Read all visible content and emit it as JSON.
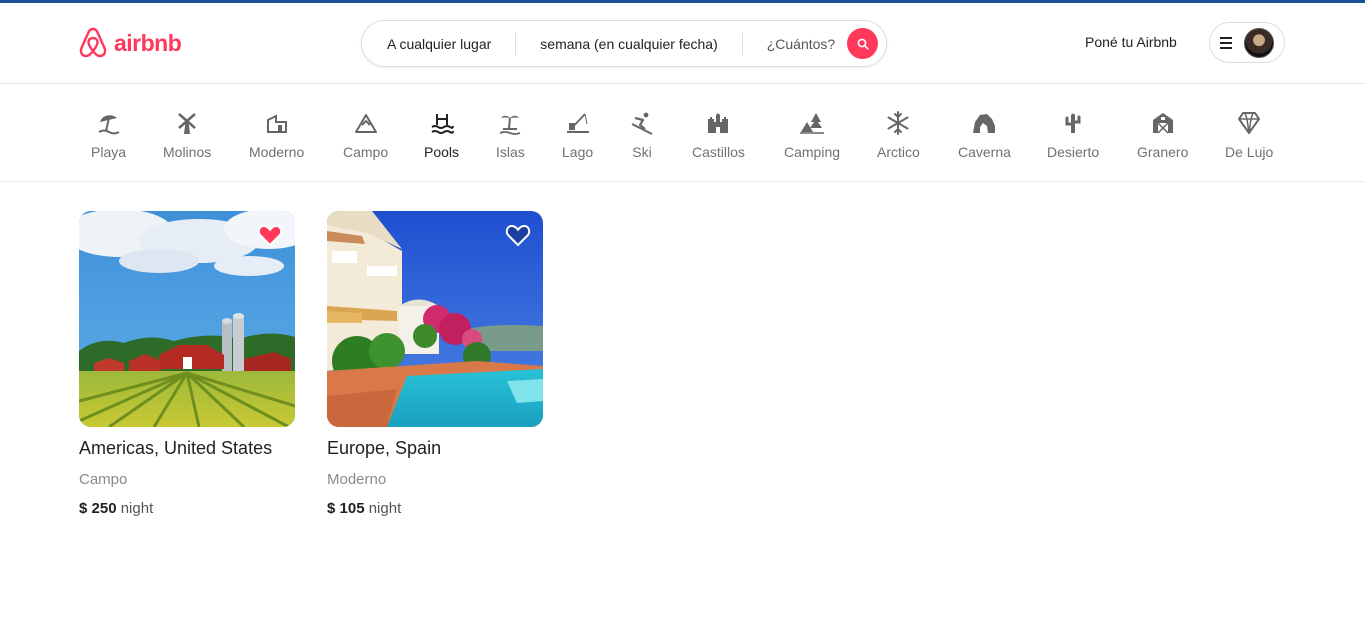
{
  "brand": {
    "name": "airbnb",
    "color": "#ff385c",
    "icon": "airbnb-logo-icon"
  },
  "search": {
    "where": "A cualquier lugar",
    "when": "semana (en cualquier fecha)",
    "who": "¿Cuántos?",
    "button_icon": "search-icon"
  },
  "header": {
    "host_link": "Poné tu Airbnb",
    "menu_icon": "hamburger-icon"
  },
  "categories": [
    {
      "label": "Playa",
      "icon": "beach-umbrella-icon"
    },
    {
      "label": "Molinos",
      "icon": "windmill-icon"
    },
    {
      "label": "Moderno",
      "icon": "modern-house-icon"
    },
    {
      "label": "Campo",
      "icon": "mountain-icon"
    },
    {
      "label": "Pools",
      "icon": "pool-icon",
      "active": true
    },
    {
      "label": "Islas",
      "icon": "palm-island-icon"
    },
    {
      "label": "Lago",
      "icon": "lake-fishing-icon"
    },
    {
      "label": "Ski",
      "icon": "skier-icon"
    },
    {
      "label": "Castillos",
      "icon": "castle-icon"
    },
    {
      "label": "Camping",
      "icon": "camping-tent-icon"
    },
    {
      "label": "Arctico",
      "icon": "snowflake-icon"
    },
    {
      "label": "Caverna",
      "icon": "cave-icon"
    },
    {
      "label": "Desierto",
      "icon": "cactus-icon"
    },
    {
      "label": "Granero",
      "icon": "barn-icon"
    },
    {
      "label": "De Lujo",
      "icon": "diamond-icon"
    }
  ],
  "listings": [
    {
      "location": "Americas, United States",
      "type": "Campo",
      "currency": "$",
      "price": "250",
      "unit": "night",
      "favorited": true,
      "photo": "farm-with-red-barns-photo"
    },
    {
      "location": "Europe, Spain",
      "type": "Moderno",
      "currency": "$",
      "price": "105",
      "unit": "night",
      "favorited": false,
      "photo": "spanish-villa-with-pool-photo"
    }
  ]
}
